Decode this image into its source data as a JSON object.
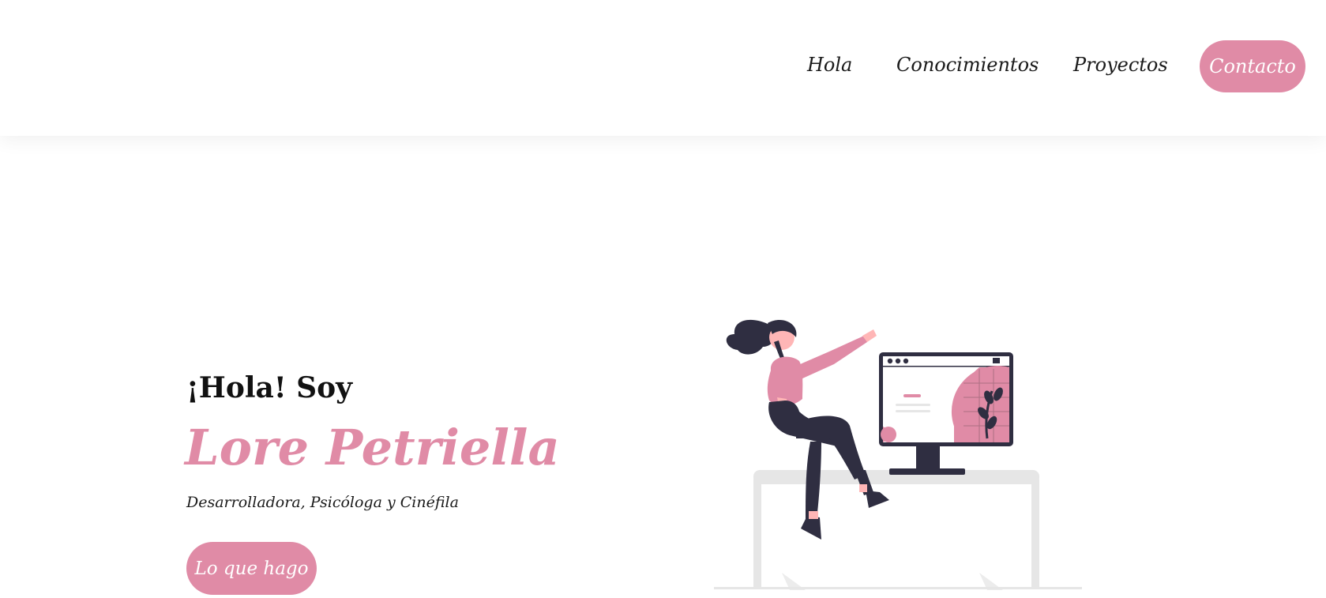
{
  "nav": {
    "links": [
      "Hola",
      "Conocimientos",
      "Proyectos"
    ],
    "contact_label": "Contacto"
  },
  "hero": {
    "greeting": "¡Hola! Soy",
    "name": "Lore Petriella",
    "subtitle": "Desarrolladora, Psicóloga y Cinéfila",
    "cta_label": "Lo que hago"
  },
  "colors": {
    "accent": "#e08ba6",
    "dark": "#2f2e41",
    "light_gray": "#e6e6e6"
  }
}
